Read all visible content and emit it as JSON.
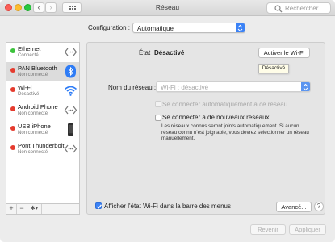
{
  "window": {
    "title": "Réseau"
  },
  "toolbar": {
    "back_glyph": "‹",
    "forward_glyph": "›",
    "show_all_icon": "grid-icon",
    "search_placeholder": "Rechercher"
  },
  "configuration": {
    "label": "Configuration :",
    "value": "Automatique"
  },
  "sidebar": {
    "items": [
      {
        "name": "Ethernet",
        "status": "Connecté",
        "status_color": "#3cc23c",
        "icon": "ethernet-arrows-icon"
      },
      {
        "name": "PAN Bluetooth",
        "status": "Non connecté",
        "status_color": "#e53b2e",
        "icon": "bluetooth-icon"
      },
      {
        "name": "Wi-Fi",
        "status": "Désactivé",
        "status_color": "#e53b2e",
        "icon": "wifi-icon"
      },
      {
        "name": "Android Phone",
        "status": "Non connecté",
        "status_color": "#e53b2e",
        "icon": "android-arrows-icon"
      },
      {
        "name": "USB iPhone",
        "status": "Non connecté",
        "status_color": "#e53b2e",
        "icon": "iphone-icon"
      },
      {
        "name": "Pont Thunderbolt",
        "status": "Non connecté",
        "status_color": "#e53b2e",
        "icon": "thunderbolt-arrows-icon"
      }
    ],
    "add_label": "+",
    "remove_label": "−",
    "action_label": "✱▾"
  },
  "detail": {
    "state_label": "État :",
    "state_value": "Désactivé",
    "activate_button": "Activer le Wi-Fi",
    "tooltip": "Désactivé",
    "network_label": "Nom du réseau :",
    "network_placeholder": "Wi-Fi : désactivé",
    "auto_join_label": "Se connecter automatiquement à ce réseau",
    "ask_new_label": "Se connecter à de nouveaux réseaux",
    "help_text": "Les réseaux connus seront joints automatiquement. Si aucun réseau connu n'est joignable, vous devrez sélectionner un réseau manuellement.",
    "show_status_label": "Afficher l'état Wi-Fi dans la barre des menus",
    "advanced_button": "Avancé...",
    "help_glyph": "?"
  },
  "footer": {
    "revert_label": "Revenir",
    "apply_label": "Appliquer"
  },
  "colors": {
    "accent": "#3b82f6",
    "connected": "#3cc23c",
    "disconnected": "#e53b2e"
  }
}
